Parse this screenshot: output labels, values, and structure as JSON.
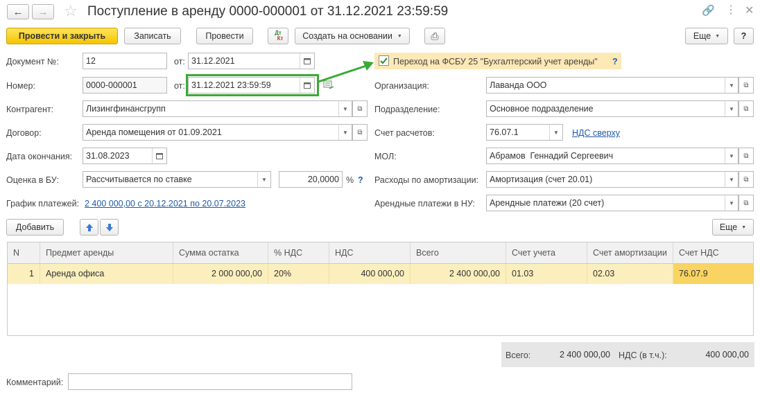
{
  "window": {
    "title": "Поступление в аренду 0000-000001 от 31.12.2021 23:59:59"
  },
  "toolbar": {
    "post_and_close": "Провести и закрыть",
    "save": "Записать",
    "post": "Провести",
    "dt_kt_top": "Дт",
    "dt_kt_bottom": "Кт",
    "create_based_on": "Создать на основании",
    "more": "Еще",
    "help": "?"
  },
  "left": {
    "doc_number_label": "Документ №:",
    "doc_number": "12",
    "doc_date_label": "от:",
    "doc_date": "31.12.2021",
    "number_label": "Номер:",
    "number": "0000-000001",
    "number_date_label": "от:",
    "number_date": "31.12.2021 23:59:59",
    "counterparty_label": "Контрагент:",
    "counterparty": "Лизингфинансгрупп",
    "contract_label": "Договор:",
    "contract": "Аренда помещения от 01.09.2021",
    "end_date_label": "Дата окончания:",
    "end_date": "31.08.2023",
    "valuation_label": "Оценка в БУ:",
    "valuation": "Рассчитывается по ставке",
    "rate": "20,0000",
    "rate_unit": "%",
    "rate_help": "?",
    "schedule_label": "График платежей:",
    "schedule_link": "2 400 000,00 с 20.12.2021 по 20.07.2023"
  },
  "right": {
    "fsbu_label": "Переход на ФСБУ 25 \"Бухгалтерский учет аренды\"",
    "fsbu_help": "?",
    "org_label": "Организация:",
    "org": "Лаванда ООО",
    "division_label": "Подразделение:",
    "division": "Основное подразделение",
    "account_label": "Счет расчетов:",
    "account": "76.07.1",
    "vat_link": "НДС сверху",
    "mol_label": "МОЛ:",
    "mol": "Абрамов  Геннадий Сергеевич",
    "amort_label": "Расходы по амортизации:",
    "amort": "Амортизация (счет 20.01)",
    "nu_label": "Арендные платежи в НУ:",
    "nu": "Арендные платежи (20 счет)"
  },
  "table_toolbar": {
    "add": "Добавить",
    "more": "Еще"
  },
  "table": {
    "columns": [
      "N",
      "Предмет аренды",
      "Сумма остатка",
      "% НДС",
      "НДС",
      "Всего",
      "Счет учета",
      "Счет амортизации",
      "Счет НДС"
    ],
    "rows": [
      [
        "1",
        "Аренда офиса",
        "2 000 000,00",
        "20%",
        "400 000,00",
        "2 400 000,00",
        "01.03",
        "02.03",
        "76.07.9"
      ]
    ]
  },
  "totals": {
    "total_label": "Всего:",
    "total": "2 400 000,00",
    "vat_label": "НДС (в т.ч.):",
    "vat": "400 000,00"
  },
  "comment": {
    "label": "Комментарий:",
    "value": ""
  },
  "colors": {
    "primary_button": "#f5c400",
    "highlight_box": "#3aaa35",
    "selected_row": "#fbefbe",
    "active_cell": "#f9d462",
    "link": "#1f5aa8"
  }
}
